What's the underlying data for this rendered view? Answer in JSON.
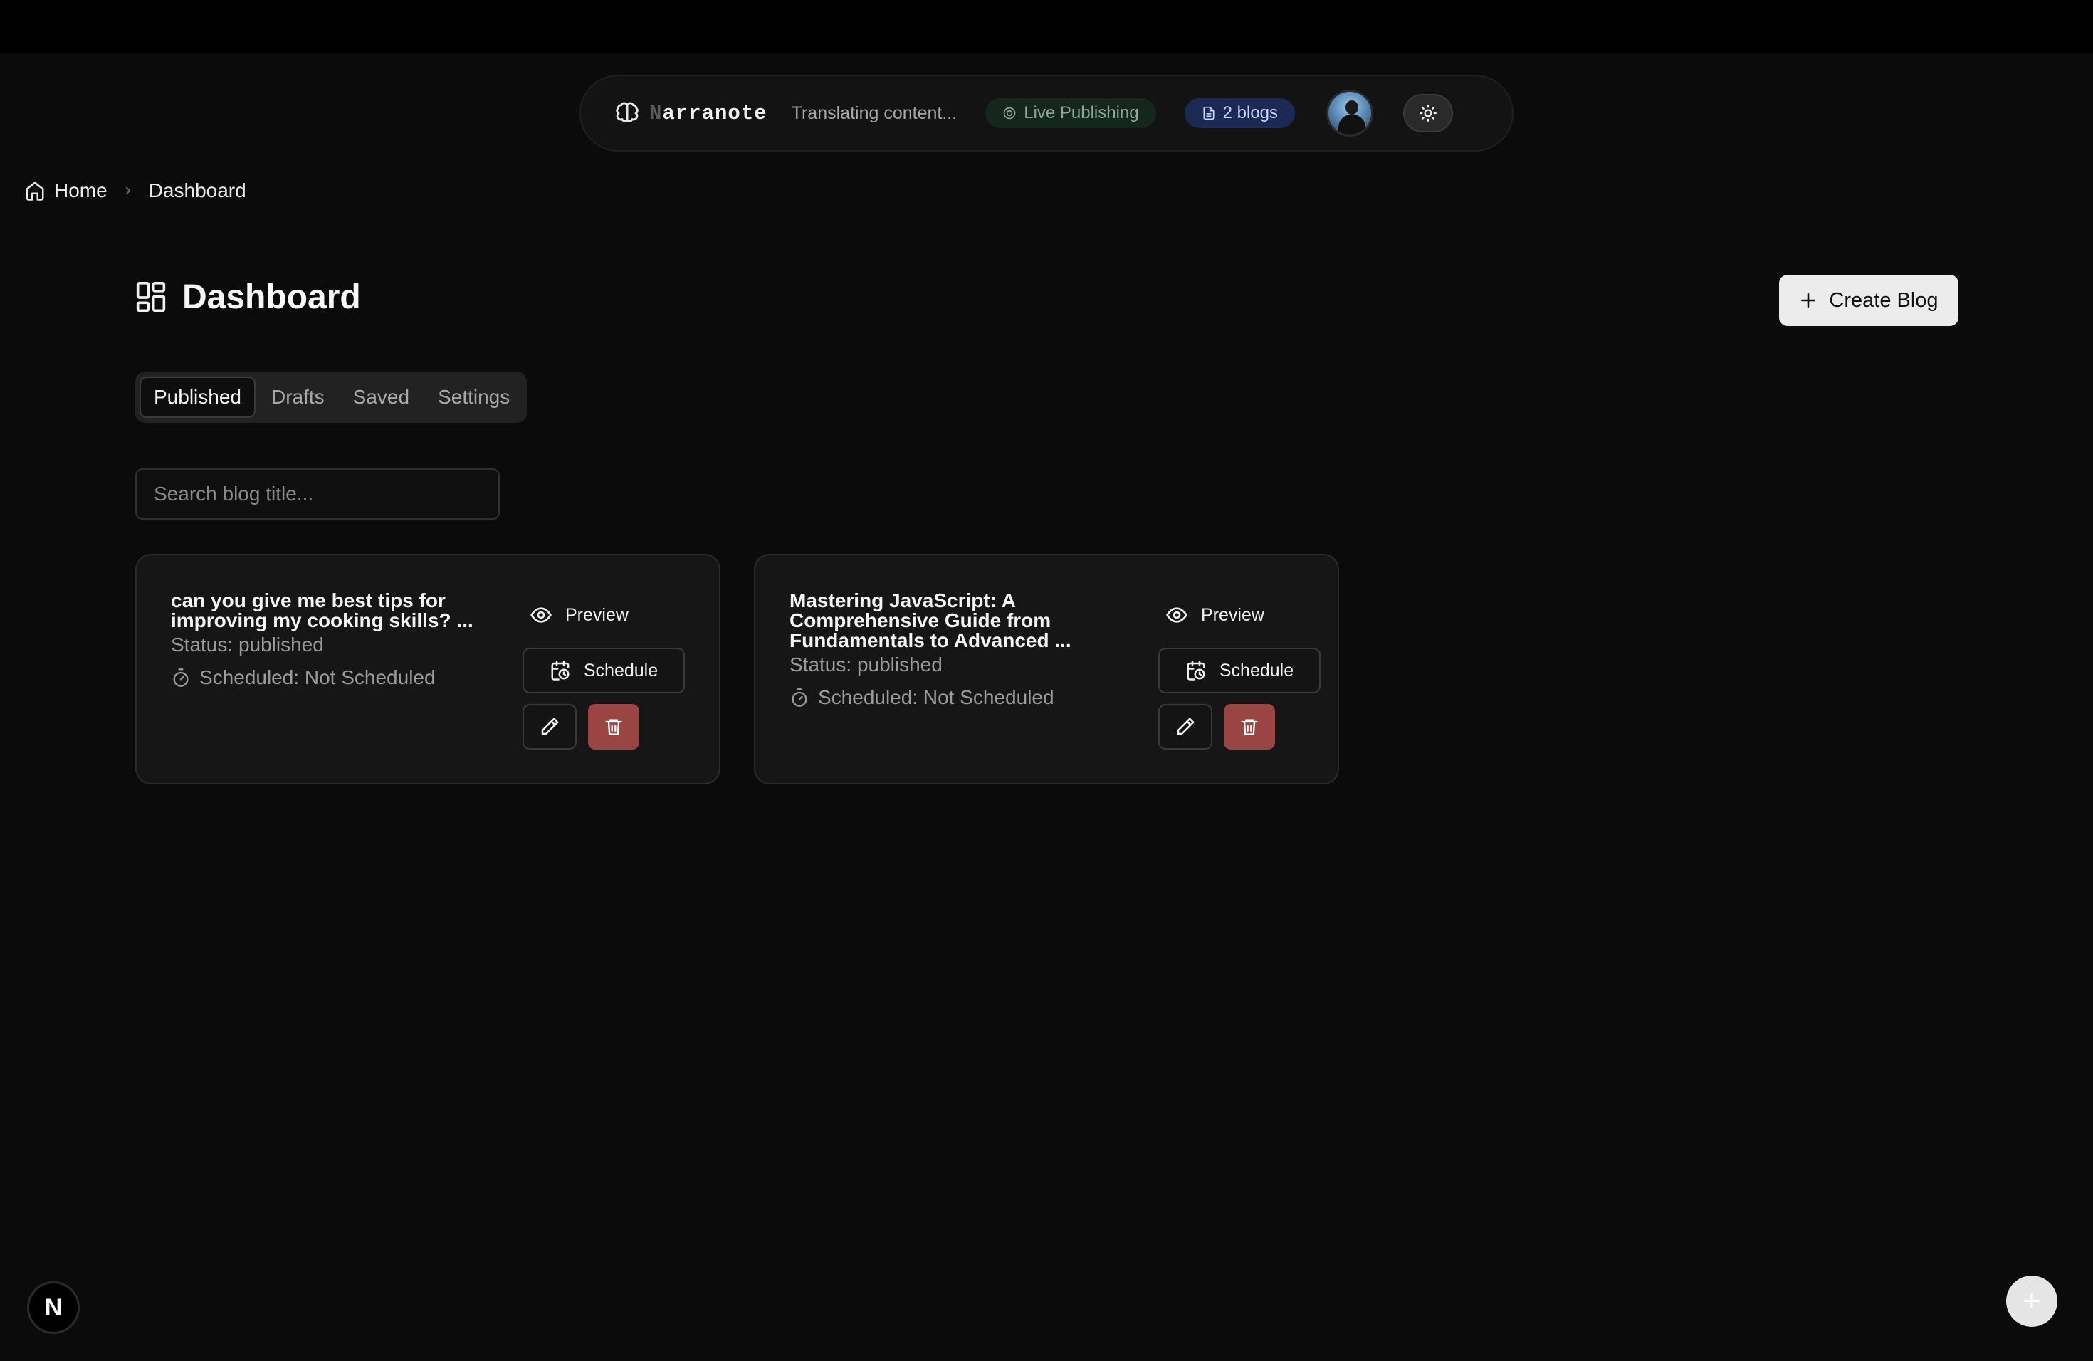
{
  "navbar": {
    "brand_first": "N",
    "brand_rest": "arranote",
    "status_text": "Translating content...",
    "live_badge": "Live Publishing",
    "blogs_badge": "2 blogs"
  },
  "breadcrumb": {
    "home": "Home",
    "current": "Dashboard"
  },
  "header": {
    "title": "Dashboard",
    "create_button": "Create Blog"
  },
  "tabs": [
    {
      "label": "Published",
      "active": true
    },
    {
      "label": "Drafts",
      "active": false
    },
    {
      "label": "Saved",
      "active": false
    },
    {
      "label": "Settings",
      "active": false
    }
  ],
  "search": {
    "placeholder": "Search blog title...",
    "value": ""
  },
  "blogs": [
    {
      "title": "can you give me best tips for improving my cooking skills? ...",
      "status": "Status: published",
      "scheduled": "Scheduled: Not Scheduled",
      "preview_label": "Preview",
      "schedule_label": "Schedule"
    },
    {
      "title": "Mastering JavaScript: A Comprehensive Guide from Fundamentals to Advanced ...",
      "status": "Status: published",
      "scheduled": "Scheduled: Not Scheduled",
      "preview_label": "Preview",
      "schedule_label": "Schedule"
    }
  ],
  "footer": {
    "next_badge": "N",
    "fab_symbol": "+"
  },
  "colors": {
    "background": "#0b0b0b",
    "card": "#161616",
    "delete": "#9b4444",
    "live_badge_bg": "#15261c",
    "blogs_badge_bg": "#1b2a55"
  },
  "icons": [
    "brain-icon",
    "radio-icon",
    "file-icon",
    "sun-icon",
    "home-icon",
    "chevron-right-icon",
    "layout-grid-icon",
    "plus-icon",
    "eye-icon",
    "calendar-clock-icon",
    "timer-icon",
    "pencil-icon",
    "trash-icon"
  ]
}
